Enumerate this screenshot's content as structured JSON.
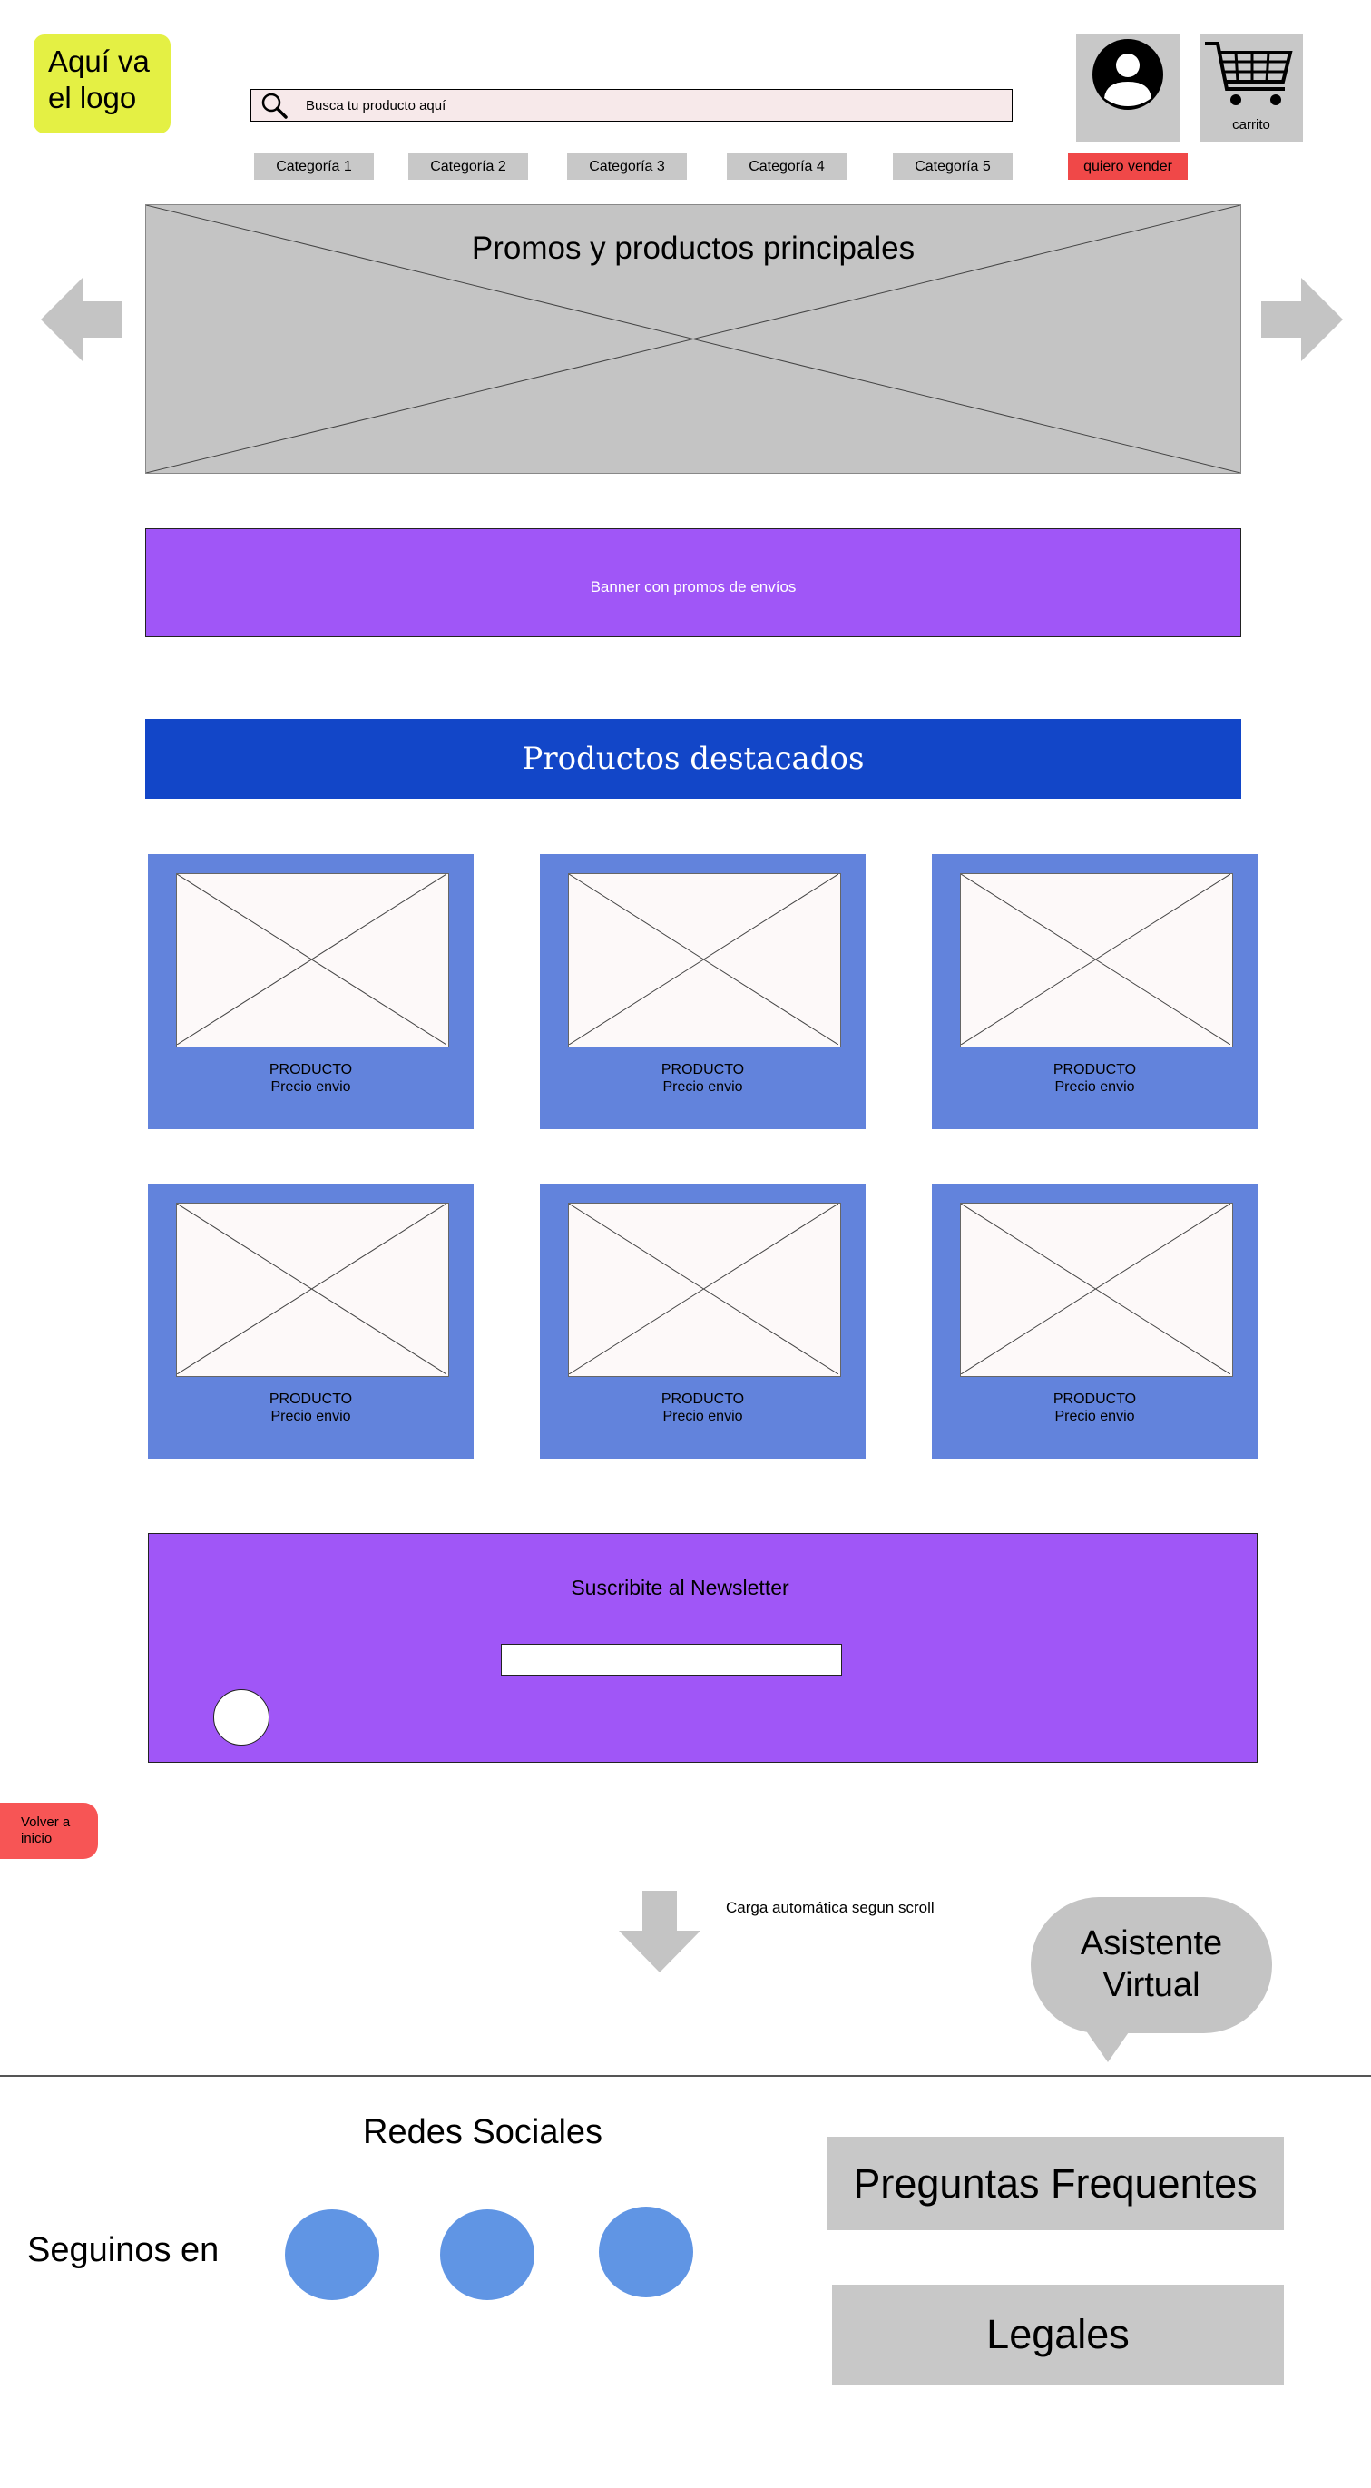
{
  "header": {
    "logo_text": "Aquí va el logo",
    "search_placeholder": "Busca tu producto aquí",
    "categories": [
      "Categoría 1",
      "Categoría 2",
      "Categoría 3",
      "Categoría 4",
      "Categoría 5"
    ],
    "sell_label": "quiero vender",
    "cart_label": "carrito"
  },
  "hero": {
    "title": "Promos y productos principales"
  },
  "shipping_banner": {
    "text": "Banner con promos de envíos"
  },
  "featured": {
    "title": "Productos destacados",
    "products": [
      {
        "name": "PRODUCTO",
        "price": "Precio envio"
      },
      {
        "name": "PRODUCTO",
        "price": "Precio envio"
      },
      {
        "name": "PRODUCTO",
        "price": "Precio envio"
      },
      {
        "name": "PRODUCTO",
        "price": "Precio envio"
      },
      {
        "name": "PRODUCTO",
        "price": "Precio envio"
      },
      {
        "name": "PRODUCTO",
        "price": "Precio envio"
      }
    ]
  },
  "newsletter": {
    "title": "Suscribite al Newsletter"
  },
  "back_to_top": {
    "label": "Volver a inicio"
  },
  "autoload": {
    "text": "Carga automática segun scroll"
  },
  "assistant": {
    "text": "Asistente Virtual"
  },
  "footer": {
    "social_title": "Redes Sociales",
    "follow_label": "Seguinos en",
    "faq_label": "Preguntas Frequentes",
    "legal_label": "Legales"
  },
  "colors": {
    "logo": "#e4f044",
    "shipping_banner": "#a056f7",
    "featured_bar": "#1246c8",
    "product_card": "#6283dc",
    "sell_button": "#f04848",
    "social_icons": "#6095e4",
    "placeholder_gray": "#c4c4c4"
  }
}
